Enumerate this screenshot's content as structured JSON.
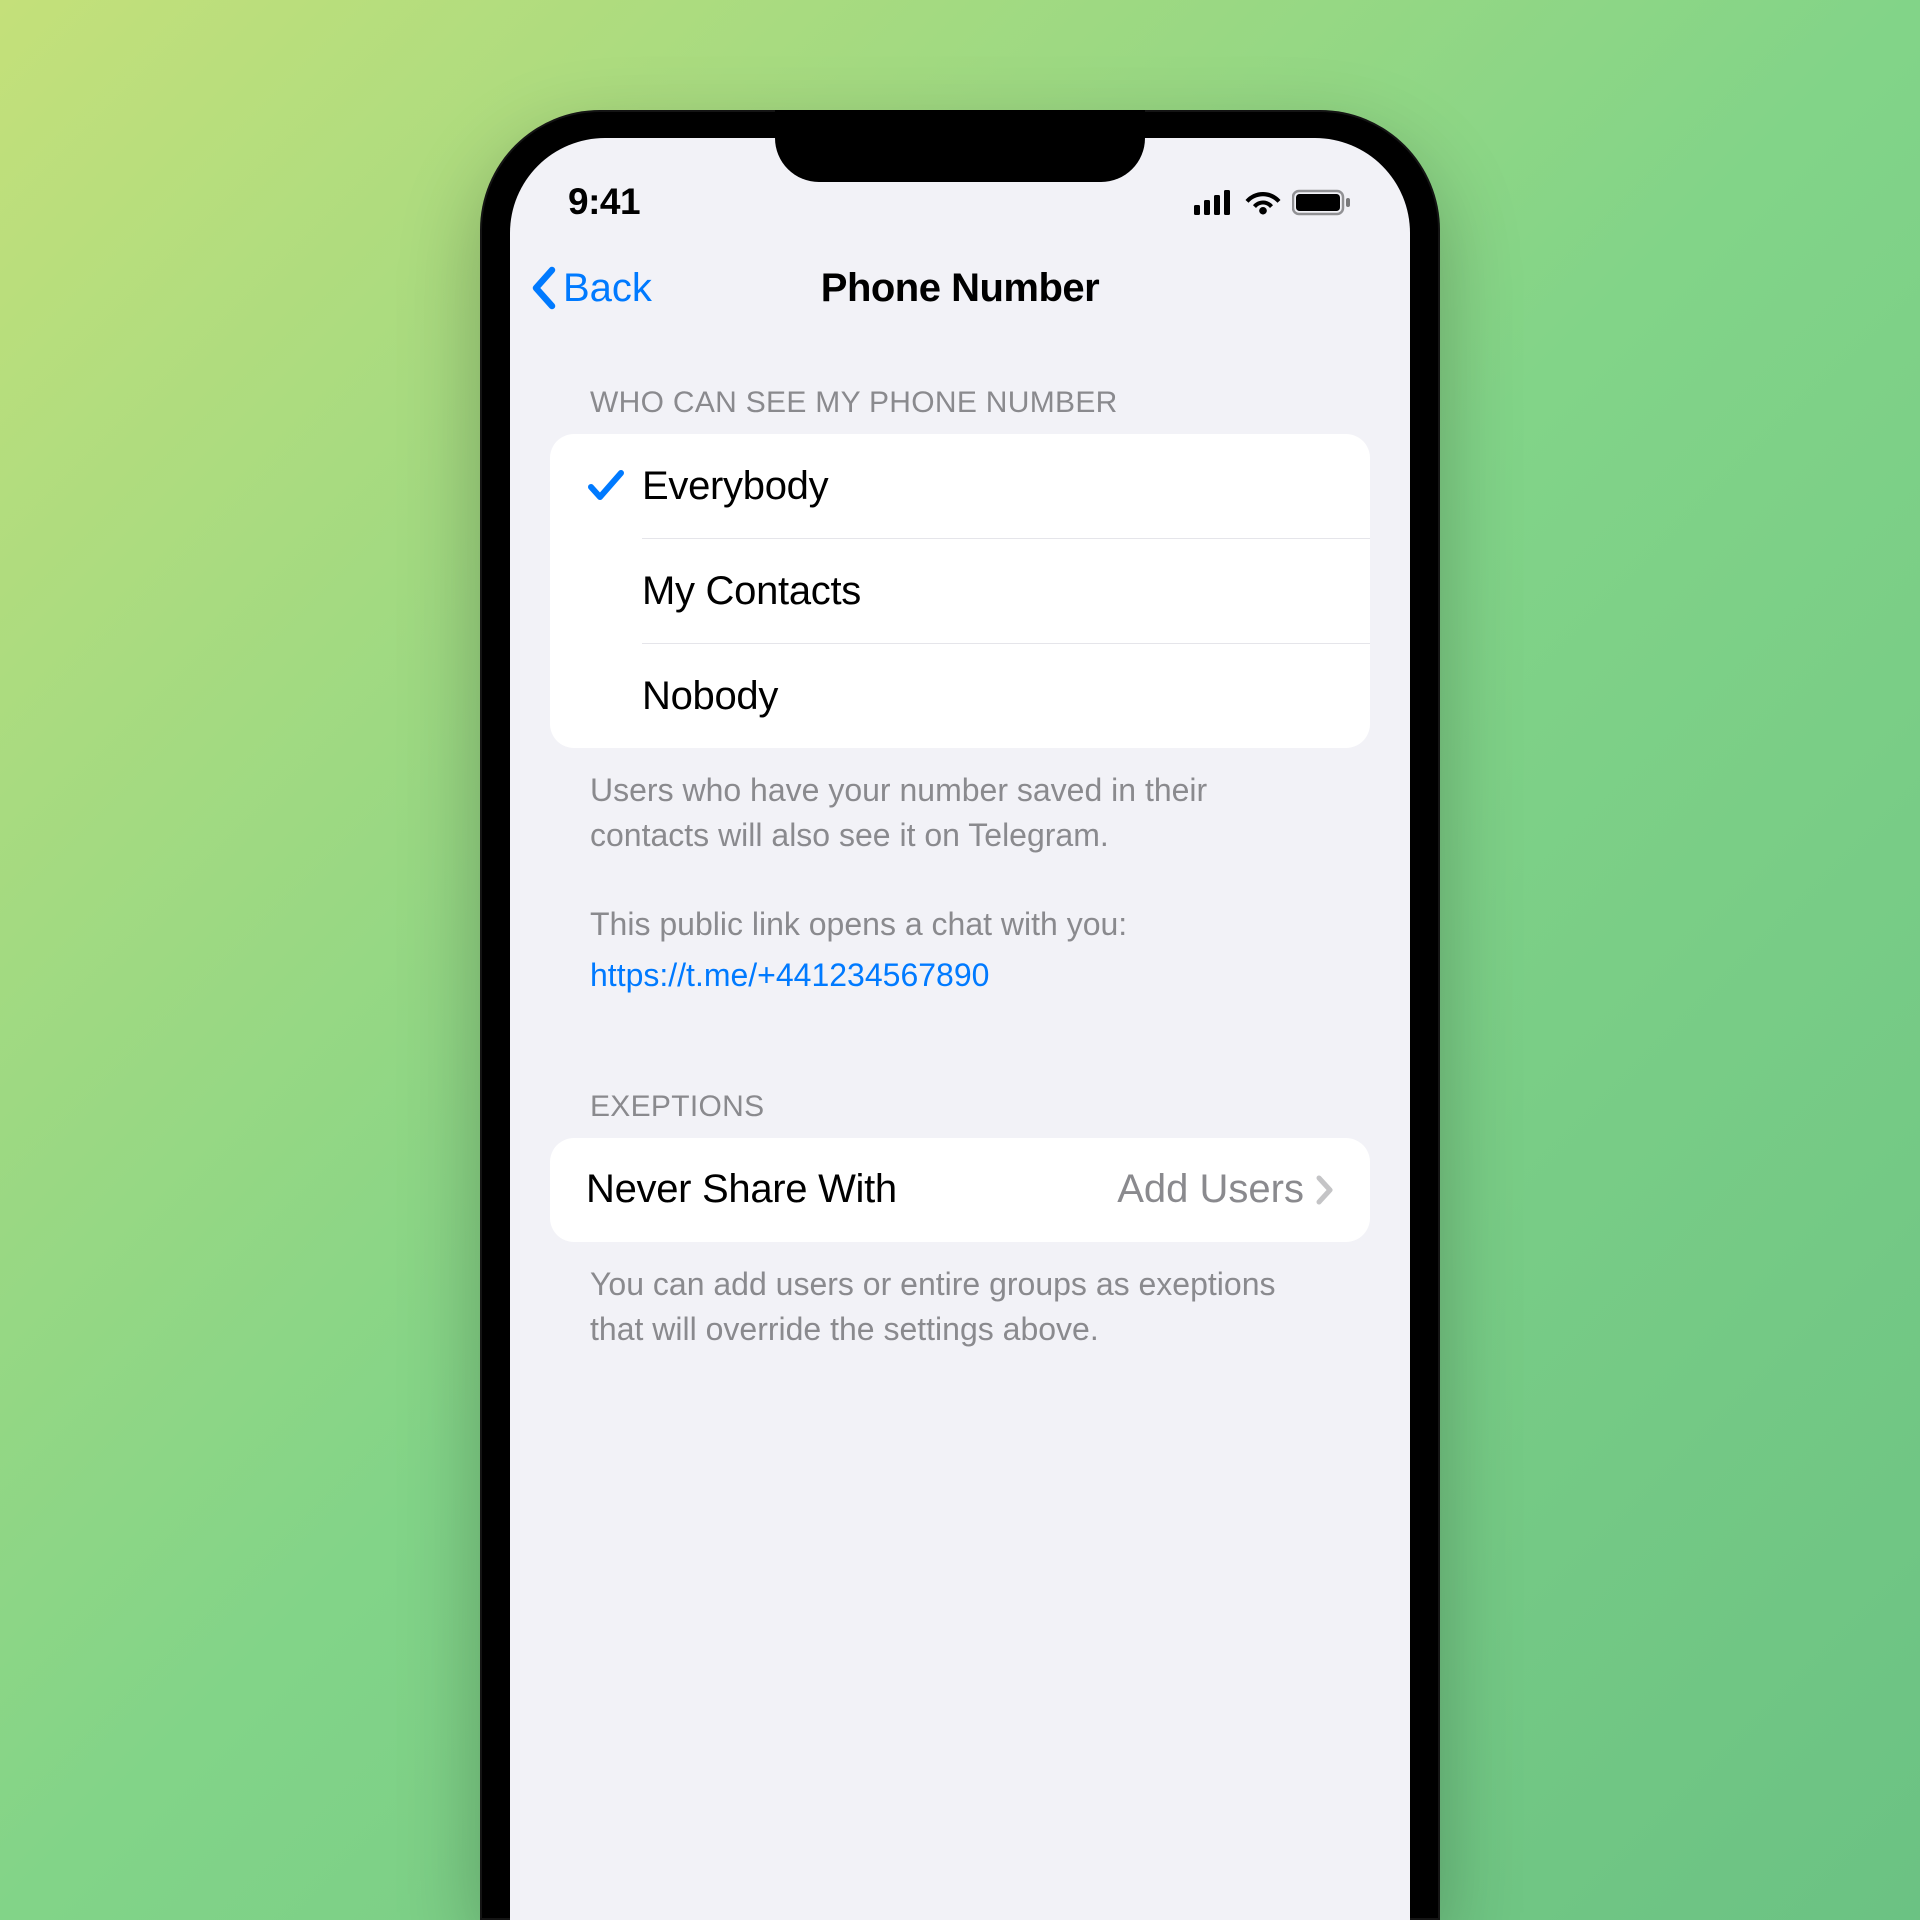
{
  "status_bar": {
    "time": "9:41"
  },
  "nav": {
    "back_label": "Back",
    "title": "Phone Number"
  },
  "section1": {
    "header": "WHO CAN SEE MY PHONE NUMBER",
    "options": {
      "everybody": "Everybody",
      "my_contacts": "My Contacts",
      "nobody": "Nobody"
    },
    "footer_line1": "Users who have your number saved in their contacts will also see it on Telegram.",
    "footer_line2": "This public link opens a chat with you:",
    "footer_link": "https://t.me/+441234567890"
  },
  "section2": {
    "header": "EXEPTIONS",
    "item_label": "Never Share With",
    "item_detail": "Add Users",
    "footer": "You can add users or entire groups as exeptions that will override the settings above."
  }
}
